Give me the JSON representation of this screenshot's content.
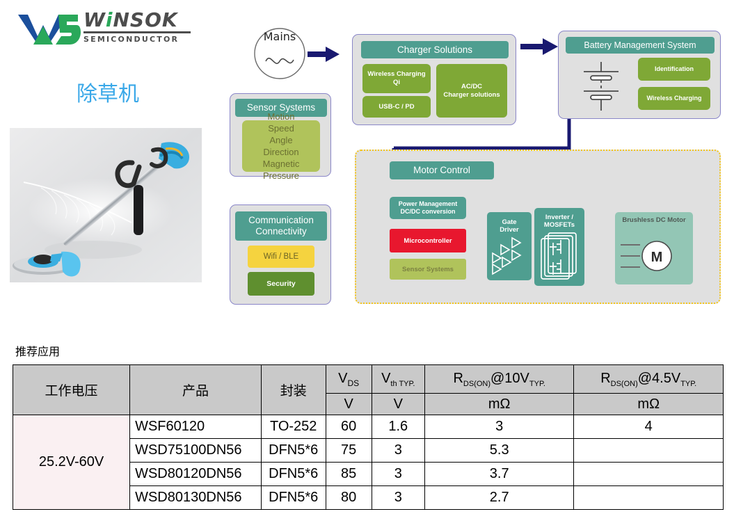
{
  "logo": {
    "wordmark": "WiNSOK",
    "subtitle": "SEMICONDUCTOR"
  },
  "page_title": "除草机",
  "product_photo": {
    "alt": "cordless grass trimmer product photo"
  },
  "diagram": {
    "mains": {
      "label": "Mains",
      "icon": "ac-sine-icon"
    },
    "arrow_mains_to_charger": "arrow-right-icon",
    "arrow_charger_to_bms": "arrow-right-icon",
    "sensor_systems": {
      "title": "Sensor Systems",
      "items": [
        "Motion",
        "Speed",
        "Angle",
        "Direction",
        "Magnetic",
        "Pressure"
      ]
    },
    "communication": {
      "title_line1": "Communication",
      "title_line2": "Connectivity",
      "wifi": "Wifi / BLE",
      "security": "Security"
    },
    "charger": {
      "title": "Charger Solutions",
      "wireless_line1": "Wireless Charging",
      "wireless_line2": "Qi",
      "usb": "USB-C / PD",
      "acdc_line1": "AC/DC",
      "acdc_line2": "Charger solutions"
    },
    "bms": {
      "title": "Battery Management System",
      "identification": "Identification",
      "wireless_charging": "Wireless Charging",
      "battery_icon": "battery-cells-icon"
    },
    "motor_control": {
      "title": "Motor Control",
      "power_mgmt_line1": "Power Management",
      "power_mgmt_line2": "DC/DC conversion",
      "microcontroller": "Microcontroller",
      "sensor_systems": "Sensor Systems",
      "gate_driver_line1": "Gate",
      "gate_driver_line2": "Driver",
      "inverter_line1": "Inverter /",
      "inverter_line2": "MOSFETs",
      "motor_block": "Brushless DC Motor",
      "motor_symbol": "M"
    }
  },
  "table_section": {
    "caption": "推荐应用",
    "headers_row1": {
      "voltage": "工作电压",
      "product": "产品",
      "package": "封装",
      "vds_main": "V",
      "vds_sub": "DS",
      "vth_main": "V",
      "vth_sub": "th TYP.",
      "rds10_main": "R",
      "rds10_sub1": "DS(ON)",
      "rds10_mid": "@10V",
      "rds10_sub2": "TYP.",
      "rds45_main": "R",
      "rds45_sub1": "DS(ON)",
      "rds45_mid": "@4.5V",
      "rds45_sub2": "TYP."
    },
    "headers_row2": {
      "vds_unit": "V",
      "vth_unit": "V",
      "rds10_unit": "mΩ",
      "rds45_unit": "mΩ"
    },
    "voltage_group": "25.2V-60V",
    "rows": [
      {
        "product": "WSF60120",
        "package": "TO-252",
        "vds": "60",
        "vth": "1.6",
        "rds10": "3",
        "rds45": "4"
      },
      {
        "product": "WSD75100DN56",
        "package": "DFN5*6",
        "vds": "75",
        "vth": "3",
        "rds10": "5.3",
        "rds45": ""
      },
      {
        "product": "WSD80120DN56",
        "package": "DFN5*6",
        "vds": "85",
        "vth": "3",
        "rds10": "3.7",
        "rds45": ""
      },
      {
        "product": "WSD80130DN56",
        "package": "DFN5*6",
        "vds": "80",
        "vth": "3",
        "rds10": "2.7",
        "rds45": ""
      }
    ]
  },
  "colors": {
    "teal_header": "#4f9e90",
    "green_box": "#7fa836",
    "olive_box": "#b0c35b",
    "yellow_box": "#f5d33f",
    "dark_green_box": "#5f8f2f",
    "red_box": "#e8172e",
    "mint_box": "#93c6b5",
    "panel_bg": "#e0e0e0",
    "panel_border": "#8a86c8",
    "dashed_border": "#f5c518",
    "arrow_navy": "#191970",
    "title_blue": "#3aa8e8",
    "table_header_gray": "#c9c9c9",
    "table_voltage_cell": "#faf0f2"
  }
}
